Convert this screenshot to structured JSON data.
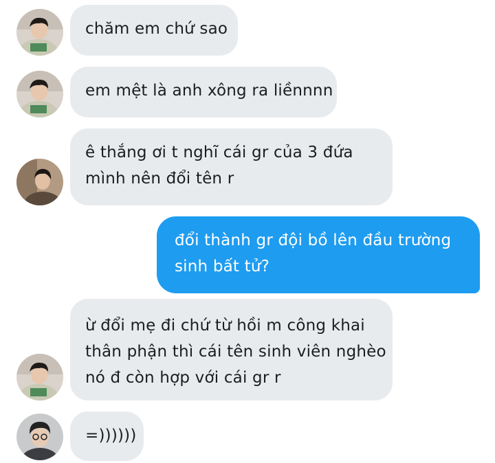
{
  "messages": [
    {
      "from": "contact-a",
      "lines": [
        "chăm em chứ sao"
      ]
    },
    {
      "from": "contact-a",
      "lines": [
        "em mệt là anh xông ra liềnnnn"
      ]
    },
    {
      "from": "contact-b",
      "lines": [
        "ê thắng ơi t nghĩ cái gr của 3 đứa",
        "mình nên đổi tên r"
      ]
    },
    {
      "from": "me",
      "lines": [
        "đổi thành gr đội bồ lên đầu trường",
        "sinh bất tử?"
      ]
    },
    {
      "from": "contact-a",
      "lines": [
        "ừ đổi mẹ đi chứ từ hồi m công khai",
        "thân phận thì cái tên sinh viên nghèo",
        "nó đ còn hợp với cái gr r"
      ]
    },
    {
      "from": "contact-c",
      "lines": [
        "=))))))"
      ]
    }
  ],
  "colors": {
    "incoming_bubble": "#e8ebee",
    "outgoing_bubble": "#1e9cf0",
    "incoming_text": "#1b1d21",
    "outgoing_text": "#ffffff"
  }
}
